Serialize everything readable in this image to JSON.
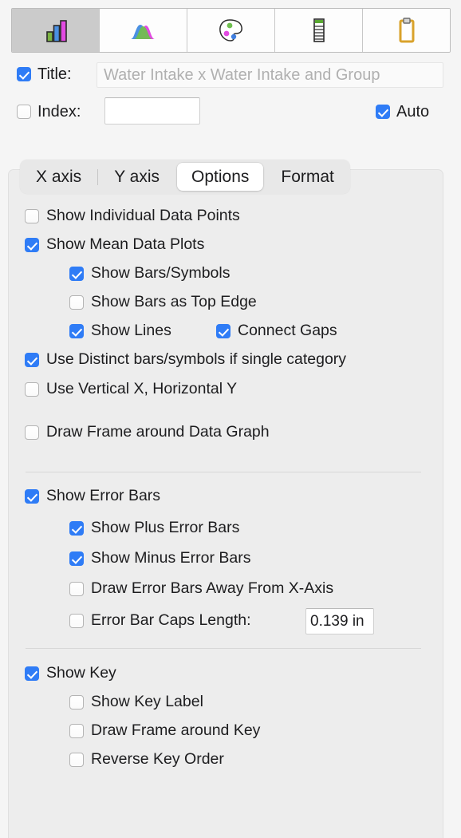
{
  "toolbar": {
    "buttons": [
      {
        "name": "bar-chart-icon",
        "label": "Graph",
        "selected": true
      },
      {
        "name": "distribution-curve-icon",
        "label": "Distribution",
        "selected": false
      },
      {
        "name": "palette-icon",
        "label": "Colors",
        "selected": false
      },
      {
        "name": "legend-icon",
        "label": "Legend",
        "selected": false
      },
      {
        "name": "clipboard-icon",
        "label": "Clipboard",
        "selected": false
      }
    ]
  },
  "title_row": {
    "checkbox_checked": true,
    "label": "Title:",
    "value": "",
    "placeholder": "Water Intake x Water Intake and Group"
  },
  "index_row": {
    "checkbox_checked": false,
    "label": "Index:",
    "value": "",
    "auto_label": "Auto",
    "auto_checked": true
  },
  "tabs": [
    {
      "label": "X axis",
      "active": false
    },
    {
      "label": "Y axis",
      "active": false
    },
    {
      "label": "Options",
      "active": true
    },
    {
      "label": "Format",
      "active": false
    }
  ],
  "options": {
    "group1": [
      {
        "label": "Show Individual Data Points",
        "checked": false,
        "indent": 0
      },
      {
        "label": "Show Mean Data Plots",
        "checked": true,
        "indent": 0
      },
      {
        "label": "Show Bars/Symbols",
        "checked": true,
        "indent": 1
      },
      {
        "label": "Show Bars as Top Edge",
        "checked": false,
        "indent": 1
      },
      {
        "label": "Show Lines",
        "checked": true,
        "indent": 1
      },
      {
        "label": "Connect Gaps",
        "checked": true,
        "indent": 2
      },
      {
        "label": "Use Distinct bars/symbols if single category",
        "checked": true,
        "indent": 0
      },
      {
        "label": "Use Vertical X, Horizontal Y",
        "checked": false,
        "indent": 0
      },
      {
        "label": "Draw Frame around Data Graph",
        "checked": false,
        "indent": 0
      }
    ],
    "group2": [
      {
        "label": "Show Error Bars",
        "checked": true,
        "indent": 0
      },
      {
        "label": "Show Plus Error Bars",
        "checked": true,
        "indent": 1
      },
      {
        "label": "Show Minus Error Bars",
        "checked": true,
        "indent": 1
      },
      {
        "label": "Draw Error Bars Away From X-Axis",
        "checked": false,
        "indent": 1
      },
      {
        "label": "Error Bar Caps Length:",
        "checked": false,
        "indent": 1
      }
    ],
    "caps_length_value": "0.139 in",
    "group3": [
      {
        "label": "Show Key",
        "checked": true,
        "indent": 0
      },
      {
        "label": "Show Key Label",
        "checked": false,
        "indent": 1
      },
      {
        "label": "Draw Frame around Key",
        "checked": false,
        "indent": 1
      },
      {
        "label": "Reverse Key Order",
        "checked": false,
        "indent": 1
      }
    ]
  },
  "colors": {
    "accent": "#2f7cf6",
    "panel_bg": "#ededed",
    "window_bg": "#f5f5f5",
    "selected_tool_bg": "#cbcbcb",
    "bar_green": "#7cb342",
    "bar_blue": "#4a90e2",
    "bar_magenta": "#e24ae2",
    "clipboard_gold": "#d9a22b"
  }
}
